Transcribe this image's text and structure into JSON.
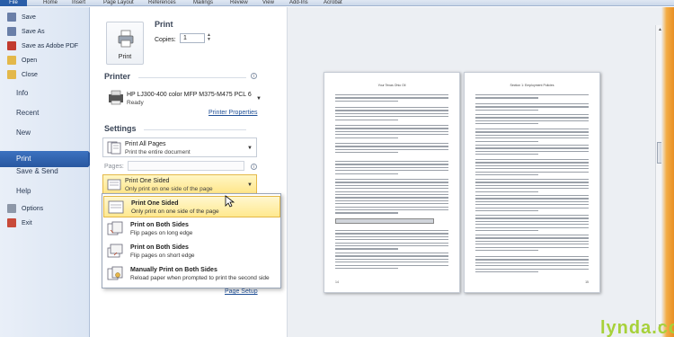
{
  "ribbon": {
    "file": "File",
    "tabs": [
      "Home",
      "Insert",
      "Page Layout",
      "References",
      "Mailings",
      "Review",
      "View",
      "Add-Ins",
      "Acrobat"
    ]
  },
  "nav": {
    "save": "Save",
    "save_as": "Save As",
    "save_pdf": "Save as Adobe PDF",
    "open": "Open",
    "close": "Close",
    "info": "Info",
    "recent": "Recent",
    "new": "New",
    "print": "Print",
    "save_send": "Save & Send",
    "help": "Help",
    "options": "Options",
    "exit": "Exit"
  },
  "print": {
    "heading": "Print",
    "button": "Print",
    "copies_label": "Copies:",
    "copies_value": "1"
  },
  "printer": {
    "heading": "Printer",
    "name": "HP LJ300-400 color MFP M375-M475 PCL 6",
    "status": "Ready",
    "properties_link": "Printer Properties"
  },
  "settings": {
    "heading": "Settings",
    "scope_title": "Print All Pages",
    "scope_sub": "Print the entire document",
    "pages_label": "Pages:",
    "sides_title": "Print One Sided",
    "sides_sub": "Only print on one side of the page",
    "page_setup_link": "Page Setup"
  },
  "menu": [
    {
      "title": "Print One Sided",
      "sub": "Only print on one side of the page"
    },
    {
      "title": "Print on Both Sides",
      "sub": "Flip pages on long edge"
    },
    {
      "title": "Print on Both Sides",
      "sub": "Flip pages on short edge"
    },
    {
      "title": "Manually Print on Both Sides",
      "sub": "Reload paper when prompted to print the second side"
    }
  ],
  "preview": {
    "page1_header": "Your Texas Ohio Oil",
    "page2_header": "Section 1: Employment Policies",
    "page1_num": "14",
    "page2_num": "15"
  },
  "watermark": "lynda.com",
  "colors": {
    "accent": "#2a5ea8",
    "selection": "#ffe68a",
    "watermark": "#a7d13a"
  }
}
